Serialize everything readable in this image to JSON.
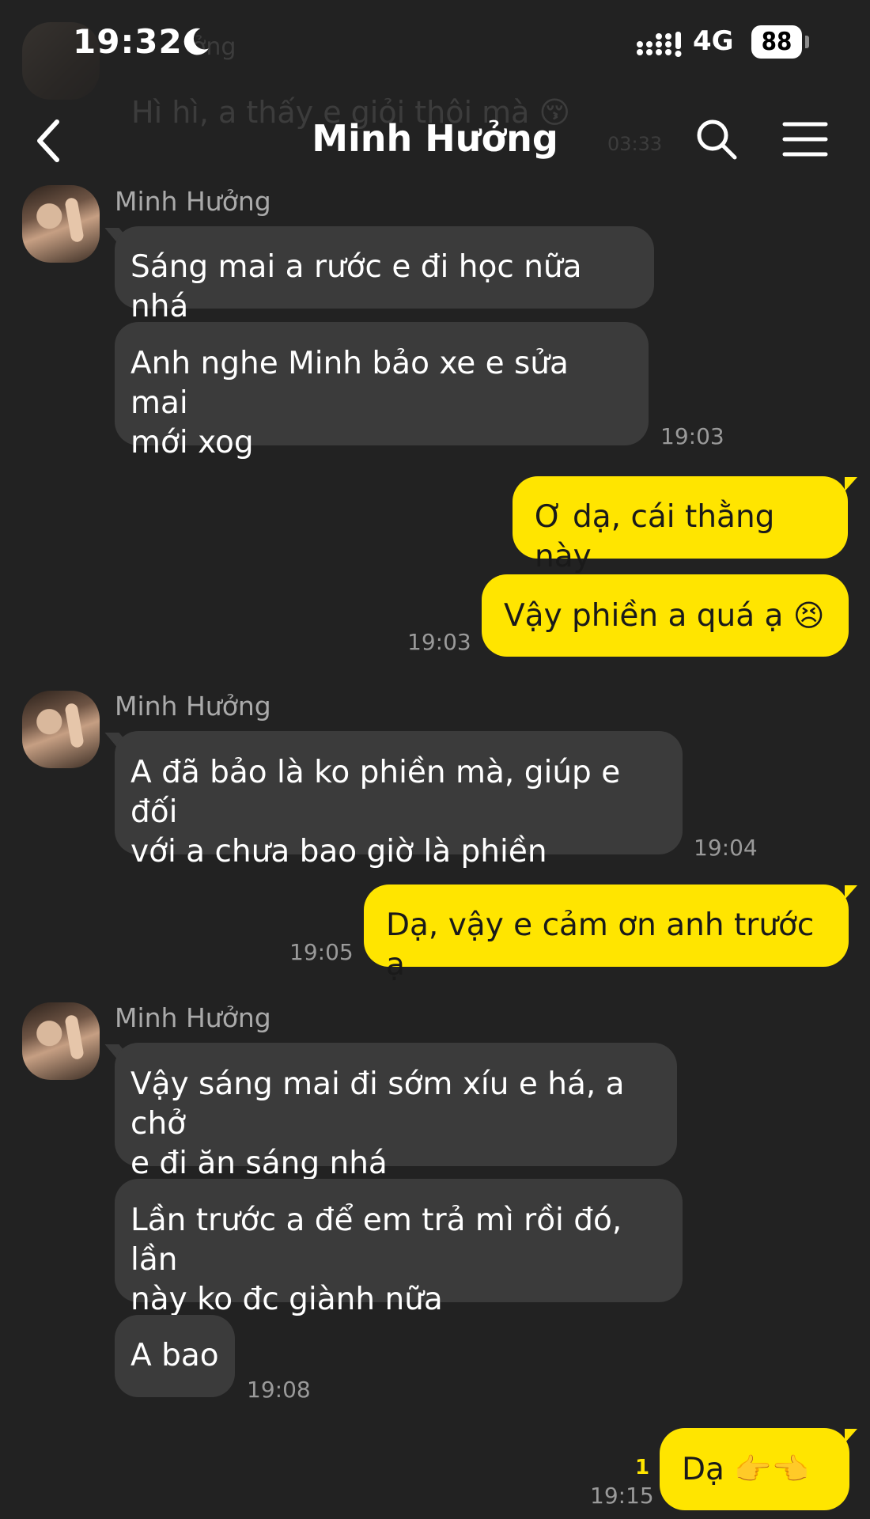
{
  "status_bar": {
    "time": "19:32",
    "network": "4G",
    "battery": "88"
  },
  "ghost": {
    "name": "ởng",
    "text": "Hì hì, a thấy e giỏi thôi mà 😚",
    "time": "03:33"
  },
  "header": {
    "title": "Minh Hưởng"
  },
  "messages": {
    "g1": {
      "sender": "Minh Hưởng",
      "m1": "Sáng mai a rước e đi học nữa nhá",
      "m2_line1": "Anh nghe Minh bảo xe e sửa mai",
      "m2_line2": "mới xog",
      "time": "19:03"
    },
    "o1": {
      "m1": "Ơ dạ, cái thằng này",
      "m2": "Vậy phiền a quá ạ",
      "m2_emoji": "😣",
      "time": "19:03"
    },
    "g2": {
      "sender": "Minh Hưởng",
      "m1_line1": "A đã bảo là ko phiền mà, giúp e đối",
      "m1_line2": "với a chưa bao giờ là phiền",
      "time": "19:04"
    },
    "o2": {
      "m1": "Dạ, vậy e cảm ơn anh trước ạ",
      "time": "19:05"
    },
    "g3": {
      "sender": "Minh Hưởng",
      "m1_line1": "Vậy sáng mai đi sớm xíu e há, a chở",
      "m1_line2": "e đi ăn sáng nhá",
      "m2_line1": "Lần trước a để em trả mì rồi đó, lần",
      "m2_line2": "này ko đc giành nữa",
      "m3": "A bao",
      "time": "19:08"
    },
    "o3": {
      "m1": "Dạ",
      "m1_emoji": "👉👈",
      "time": "19:15",
      "unread": "1"
    }
  }
}
